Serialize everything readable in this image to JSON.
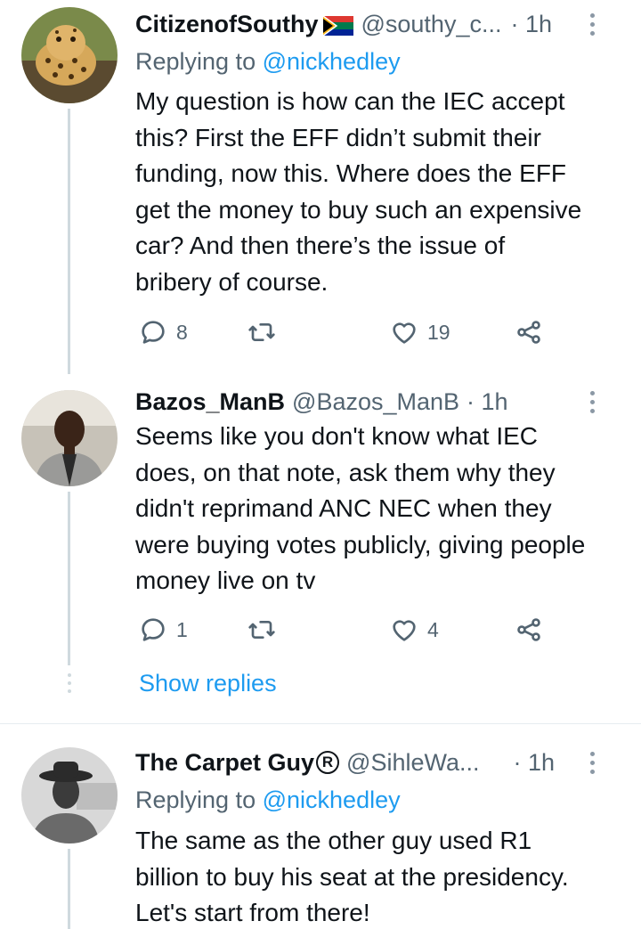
{
  "tweets": [
    {
      "name": "CitizenofSouthy",
      "handle": "@southy_c...",
      "time": "· 1h",
      "reply_prefix": "Replying to",
      "reply_to": "@nickhedley",
      "lines": [
        "My question is how can the IEC accept",
        "this? First the EFF didn’t submit their",
        "funding, now this. Where does the EFF",
        "get the money to buy such an expensive",
        "car? And then there’s the issue of",
        "bribery of course."
      ],
      "replies": "8",
      "retweets": "",
      "likes": "19"
    },
    {
      "name": "Bazos_ManB",
      "handle": "@Bazos_ManB",
      "time": "· 1h",
      "lines": [
        "Seems like you don't know what IEC",
        "does, on that note, ask them why they",
        "didn't reprimand ANC NEC when they",
        "were buying votes publicly, giving people",
        "money live on tv"
      ],
      "replies": "1",
      "retweets": "",
      "likes": "4"
    },
    {
      "name": "The Carpet Guy",
      "handle": "@SihleWa...",
      "time": "· 1h",
      "reply_prefix": "Replying to",
      "reply_to": "@nickhedley",
      "lines": [
        "The same as the other guy used R1",
        "billion to buy his seat at the presidency.",
        "Let's start from there!"
      ]
    }
  ],
  "show_replies": "Show replies",
  "badge_registered": "R",
  "icons": {
    "reply": "reply-icon",
    "retweet": "retweet-icon",
    "like": "heart-icon",
    "share": "share-icon",
    "more": "more-icon",
    "flag": "south-africa-flag-icon"
  },
  "colors": {
    "link": "#1d9bf0",
    "secondary": "#536471",
    "text": "#0f1419",
    "thread_line": "#cfd9de"
  }
}
